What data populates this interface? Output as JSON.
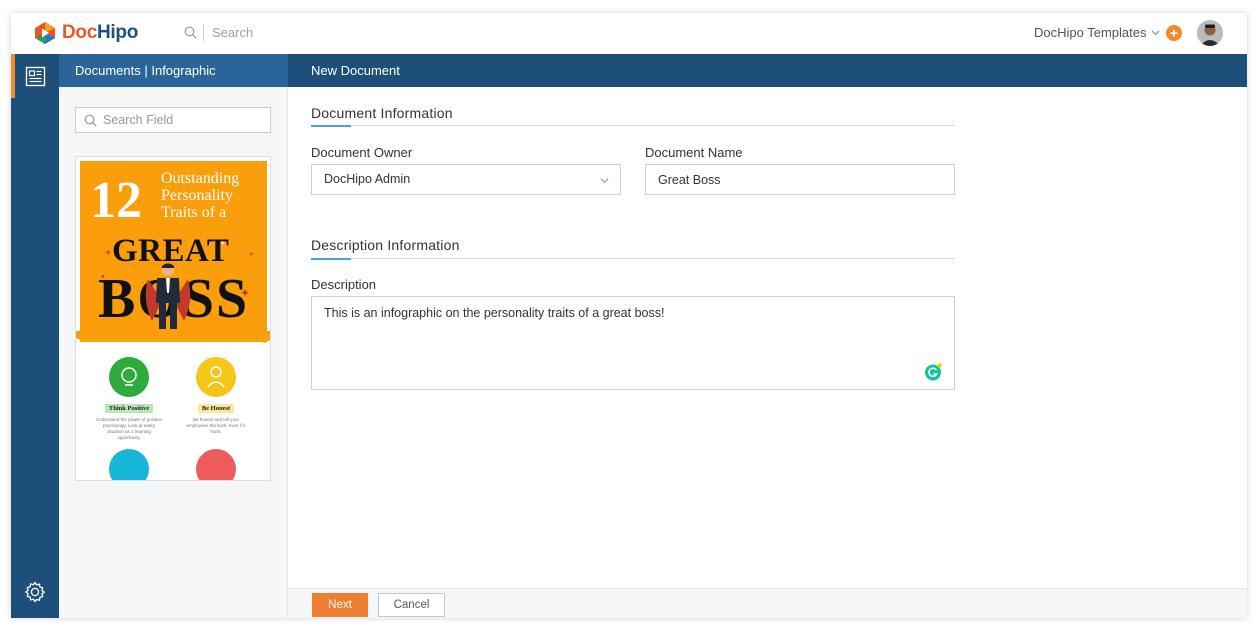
{
  "app": {
    "logo_doc": "Doc",
    "logo_hipo": "Hipo"
  },
  "topbar": {
    "search_placeholder": "Search",
    "templates_label": "DocHipo Templates",
    "add_label": "+"
  },
  "header": {
    "section_label": "Documents | Infographic",
    "page_title": "New Document"
  },
  "sidebar": {
    "search_placeholder": "Search Field",
    "thumbnail": {
      "number": "12",
      "title_lines": "Outstanding\nPersonality\nTraits of a",
      "great": "GREAT",
      "boss": "BOSS",
      "traits": [
        {
          "tag": "Think Positive",
          "desc": "Understand the power of positive psychology. Look at every situation as a learning opportunity."
        },
        {
          "tag": "Be Honest",
          "desc": "Be honest and tell your employees the truth, even if it hurts."
        }
      ]
    }
  },
  "form": {
    "document_info_title": "Document Information",
    "owner_label": "Document Owner",
    "owner_value": "DocHipo Admin",
    "name_label": "Document Name",
    "name_value": "Great Boss",
    "description_info_title": "Description Information",
    "description_label": "Description",
    "description_value": "This is an infographic on the personality traits of a great boss!"
  },
  "footer": {
    "next_label": "Next",
    "cancel_label": "Cancel"
  },
  "colors": {
    "nav_blue": "#1d4f7a",
    "band_light": "#2a6498",
    "accent_orange": "#ef7e31",
    "cover_orange": "#fb9e0c"
  }
}
